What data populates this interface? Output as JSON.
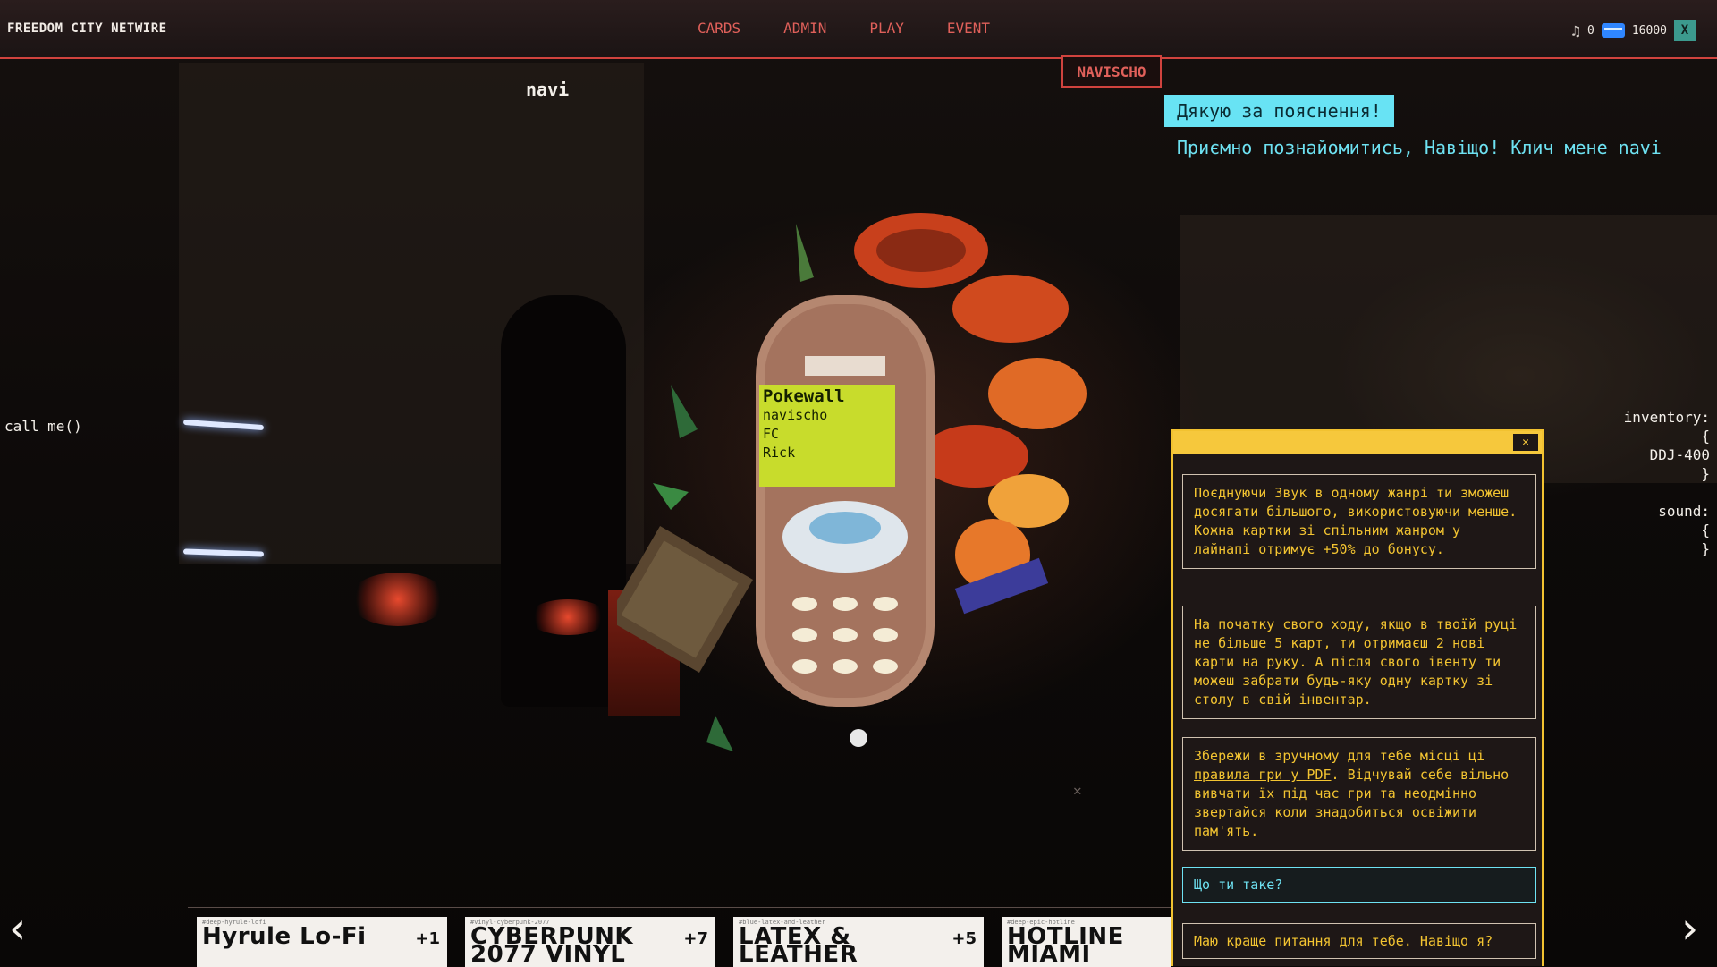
{
  "app": {
    "title": "FREEDOM CITY NETWIRE"
  },
  "nav": [
    {
      "label": "CARDS"
    },
    {
      "label": "ADMIN"
    },
    {
      "label": "PLAY"
    },
    {
      "label": "EVENT"
    }
  ],
  "stats": {
    "count": "0",
    "credits": "16000",
    "close_label": "X"
  },
  "player": {
    "badge": "NAVISCHO"
  },
  "npc": {
    "name": "navi",
    "action": "call me()"
  },
  "dialog": {
    "user_message": "Дякую за пояснення!",
    "npc_message": "Приємно познайомитись, Навіщо! Клич мене navi"
  },
  "inventory": {
    "text": "inventory:\n{\nDDJ-400\n}\n\nsound:\n{\n}"
  },
  "pokewall": {
    "title": "Pokewall",
    "lines": [
      "navischo",
      "FC",
      "Rick"
    ]
  },
  "rules_panel": {
    "close_label": "✕",
    "rules": [
      "Поєднуючи Звук в одному жанрі ти зможеш досягати більшого, використовуючи менше. Кожна картки зі спільним жанром у лайнапі отримує +50% до бонусу.",
      "На початку свого ходу, якщо в твоїй руці не більше 5 карт, ти отримаєш 2 нові карти на руку. А після свого івенту ти можеш забрати будь-яку одну картку зі столу в свій інвентар.",
      {
        "before": "Збережи в зручному для тебе місці ці ",
        "link": "правила гри у PDF",
        "after": ". Відчувай себе вільно вивчати їх під час гри та неодмінно звертайся коли знадобиться освіжити пам'ять."
      }
    ],
    "questions": [
      "Що ти таке?",
      "Маю краще питання для тебе. Навіщо я?"
    ]
  },
  "cards": [
    {
      "tag": "#deep-hyrule-lofi",
      "title": "Hyrule Lo-Fi",
      "bonus": "+1"
    },
    {
      "tag": "#vinyl-cyberpunk-2077",
      "title": "CYBERPUNK 2077 VINYL",
      "bonus": "+7"
    },
    {
      "tag": "#blue-latex-and-leather",
      "title": "LATEX & LEATHER",
      "bonus": "+5"
    },
    {
      "tag": "#deep-epic-hotline",
      "title": "HOTLINE MIAMI",
      "bonus": ""
    }
  ],
  "nav_arrows": {
    "prev": "‹",
    "next": "›"
  },
  "colors": {
    "accent_red": "#d0433e",
    "cyan": "#6ee2f2",
    "yellow": "#f3c431"
  }
}
